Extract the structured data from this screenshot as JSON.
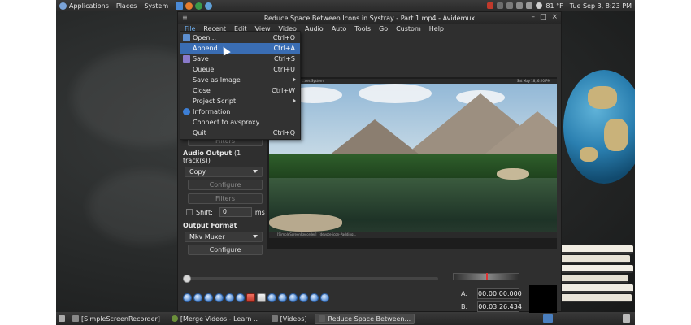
{
  "top_panel": {
    "menus": [
      "Applications",
      "Places",
      "System"
    ],
    "weather": "81 °F",
    "datetime": "Tue Sep 3,  8:23 PM"
  },
  "window": {
    "title": "Reduce Space Between Icons in Systray - Part 1.mp4 - Avidemux",
    "menu": [
      "File",
      "Recent",
      "Edit",
      "View",
      "Video",
      "Audio",
      "Auto",
      "Tools",
      "Go",
      "Custom",
      "Help"
    ]
  },
  "file_menu": {
    "items": [
      {
        "label": "Open...",
        "shortcut": "Ctrl+O",
        "icon": "open-icon"
      },
      {
        "label": "Append...",
        "shortcut": "Ctrl+A",
        "highlighted": true
      },
      {
        "label": "Save",
        "shortcut": "Ctrl+S",
        "icon": "save-icon"
      },
      {
        "label": "Queue",
        "shortcut": "Ctrl+U"
      },
      {
        "label": "Save as Image",
        "shortcut": "",
        "submenu": true
      },
      {
        "label": "Close",
        "shortcut": "Ctrl+W"
      },
      {
        "label": "Project Script",
        "shortcut": "",
        "submenu": true
      },
      {
        "label": "Information",
        "shortcut": "",
        "icon": "info-icon"
      },
      {
        "label": "Connect to avsproxy",
        "shortcut": ""
      },
      {
        "label": "Quit",
        "shortcut": "Ctrl+Q"
      }
    ]
  },
  "left_panel": {
    "video_filters_label": "Filters",
    "audio_output_title": "Audio Output",
    "audio_tracks": "(1 track(s))",
    "audio_codec": "Copy",
    "configure_label": "Configure",
    "filters_label": "Filters",
    "shift_label": "Shift:",
    "shift_value": "0",
    "shift_unit": "ms",
    "output_format_title": "Output Format",
    "output_format_value": "Mkv Muxer",
    "output_configure_label": "Configure"
  },
  "video_overlay": {
    "panel_text": "...ces   System",
    "panel_date": "Sat May 18,  6:20 PM",
    "taskbar_left": "[SimpleScreenRecorder]",
    "taskbar_right": "[devote-icon-Padding..."
  },
  "timing": {
    "a_label": "A:",
    "a_value": "00:00:00.000",
    "b_label": "B:",
    "b_value": "00:03:26.434"
  },
  "taskbar": {
    "tasks": [
      {
        "label": "[SimpleScreenRecorder]"
      },
      {
        "label": "[Merge Videos - Learn ..."
      },
      {
        "label": "[Videos]"
      },
      {
        "label": "Reduce Space Between..."
      }
    ]
  },
  "colors": {
    "accent": "#3a6db3",
    "window_bg": "#2f2f2f",
    "panel_bg": "#2a2a2a"
  }
}
